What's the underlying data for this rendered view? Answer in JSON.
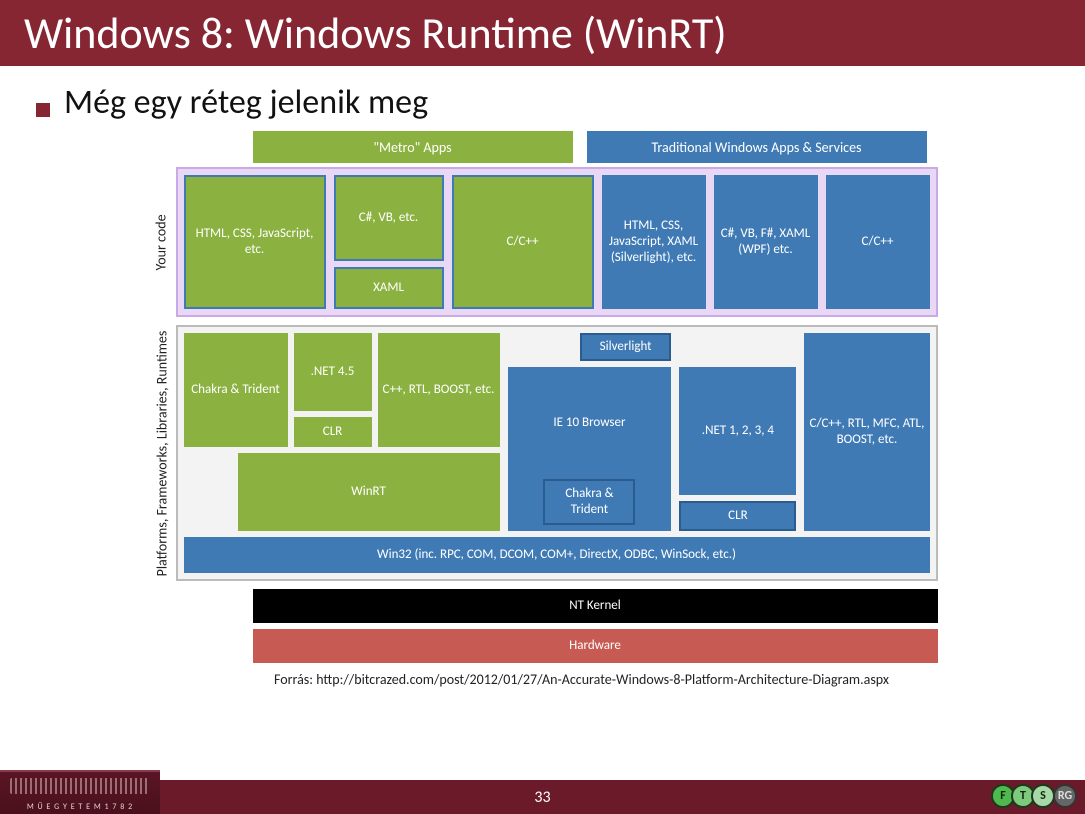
{
  "title": "Windows 8: Windows Runtime (WinRT)",
  "bullet": "Még egy réteg jelenik meg",
  "headers": {
    "metro": "\"Metro\" Apps",
    "trad": "Traditional Windows Apps & Services"
  },
  "yourcode": {
    "label": "Your code",
    "metro": {
      "html": "HTML, CSS, JavaScript, etc.",
      "csharp": "C#, VB, etc.",
      "xaml": "XAML",
      "cpp": "C/C++"
    },
    "trad": {
      "html": "HTML, CSS, JavaScript, XAML (Silverlight), etc.",
      "csharp": "C#, VB, F#, XAML (WPF) etc.",
      "cpp": "C/C++"
    }
  },
  "runtimes": {
    "label": "Platforms, Frameworks, Libraries, Runtimes",
    "left": {
      "chakra": "Chakra & Trident",
      "net45": ".NET 4.5",
      "clr": "CLR",
      "cpprtl": "C++, RTL, BOOST, etc.",
      "winrt": "WinRT"
    },
    "right": {
      "silverlight": "Silverlight",
      "ie10": "IE 10 Browser",
      "chakra": "Chakra & Trident",
      "net1234": ".NET 1, 2, 3, 4",
      "clr": "CLR",
      "native": "C/C++, RTL, MFC, ATL, BOOST, etc."
    },
    "win32": "Win32 (inc. RPC, COM, DCOM, COM+, DirectX, ODBC, WinSock, etc.)"
  },
  "kernel": "NT Kernel",
  "hardware": "Hardware",
  "source": "Forrás: http://bitcrazed.com/post/2012/01/27/An-Accurate-Windows-8-Platform-Architecture-Diagram.aspx",
  "page": "33",
  "uni": "MŰEGYETEM 1782",
  "logos": [
    "F",
    "T",
    "S",
    "RG"
  ]
}
